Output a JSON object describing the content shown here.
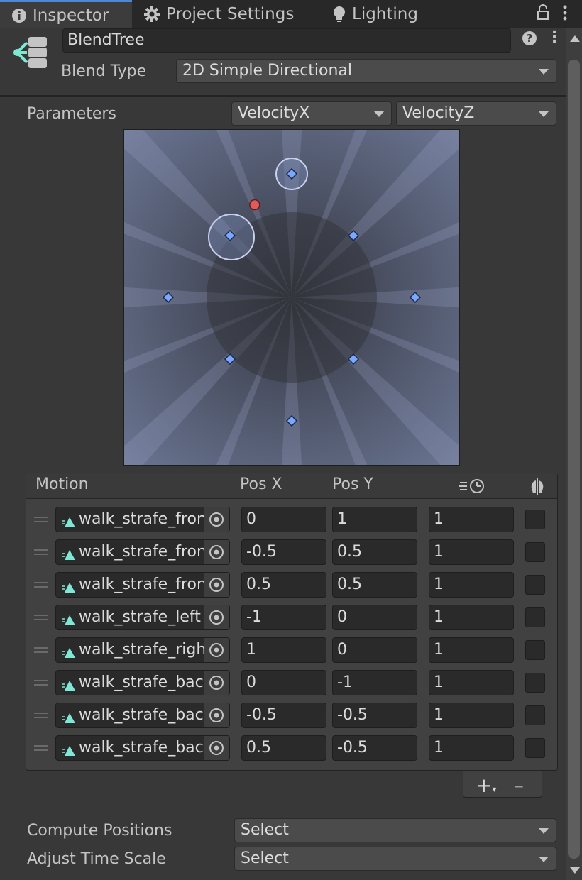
{
  "tabs": [
    {
      "label": "Inspector",
      "icon": "info-icon"
    },
    {
      "label": "Project Settings",
      "icon": "gear-icon"
    },
    {
      "label": "Lighting",
      "icon": "lightbulb-icon"
    }
  ],
  "header": {
    "name": "BlendTree",
    "blend_type_label": "Blend Type",
    "blend_type_value": "2D Simple Directional"
  },
  "parameters": {
    "label": "Parameters",
    "x_param": "VelocityX",
    "y_param": "VelocityZ"
  },
  "graph": {
    "current_point": {
      "x": -0.3,
      "y": 0.75
    },
    "points": [
      {
        "x": 0,
        "y": 1,
        "highlighted": true
      },
      {
        "x": -0.5,
        "y": 0.5,
        "highlighted": true
      },
      {
        "x": 0.5,
        "y": 0.5
      },
      {
        "x": -1,
        "y": 0
      },
      {
        "x": 1,
        "y": 0
      },
      {
        "x": 0,
        "y": -1
      },
      {
        "x": -0.5,
        "y": -0.5
      },
      {
        "x": 0.5,
        "y": -0.5
      }
    ]
  },
  "motion_table": {
    "headers": {
      "motion": "Motion",
      "pos_x": "Pos X",
      "pos_y": "Pos Y"
    },
    "rows": [
      {
        "motion": "walk_strafe_front",
        "pos_x": "0",
        "pos_y": "1",
        "speed": "1"
      },
      {
        "motion": "walk_strafe_front_left",
        "pos_x": "-0.5",
        "pos_y": "0.5",
        "speed": "1"
      },
      {
        "motion": "walk_strafe_front_right",
        "pos_x": "0.5",
        "pos_y": "0.5",
        "speed": "1"
      },
      {
        "motion": "walk_strafe_left",
        "pos_x": "-1",
        "pos_y": "0",
        "speed": "1"
      },
      {
        "motion": "walk_strafe_right",
        "pos_x": "1",
        "pos_y": "0",
        "speed": "1"
      },
      {
        "motion": "walk_strafe_back",
        "pos_x": "0",
        "pos_y": "-1",
        "speed": "1"
      },
      {
        "motion": "walk_strafe_back_left",
        "pos_x": "-0.5",
        "pos_y": "-0.5",
        "speed": "1"
      },
      {
        "motion": "walk_strafe_back_right",
        "pos_x": "0.5",
        "pos_y": "-0.5",
        "speed": "1"
      }
    ]
  },
  "footer": {
    "compute_positions_label": "Compute Positions",
    "compute_positions_value": "Select",
    "adjust_time_scale_label": "Adjust Time Scale",
    "adjust_time_scale_value": "Select"
  },
  "colors": {
    "accent": "#4d88d6",
    "point": "#7aa7ff",
    "current_point": "#e05a5a",
    "clip_icon": "#7fe7d4"
  }
}
